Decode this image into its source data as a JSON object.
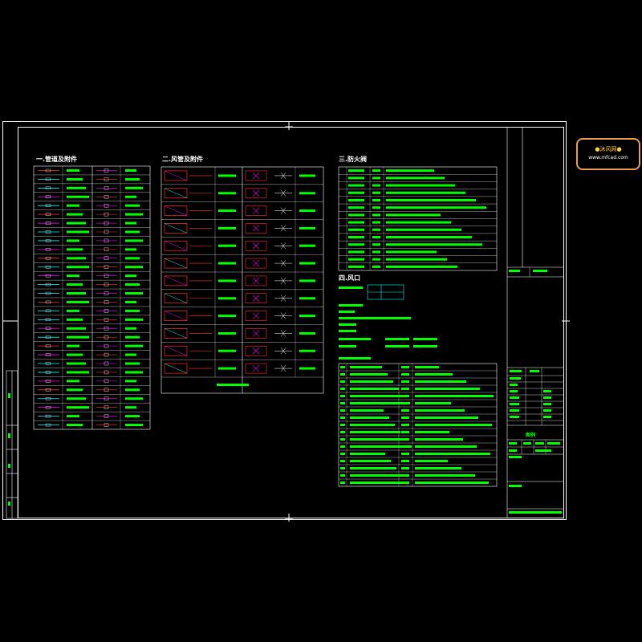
{
  "logo": {
    "line1": "●沐风网●",
    "line2": "www.mfcad.com"
  },
  "sections": {
    "s1": "一.管道及附件",
    "s2": "二.风管及附件",
    "s3": "三.防火阀",
    "s4": "四.风口"
  },
  "colors": {
    "frame": "#ffffff",
    "text": "#00ff00",
    "symbol_red": "#ff3030",
    "symbol_magenta": "#ff00ff",
    "symbol_cyan": "#00ffff",
    "symbol_yellow": "#ffff00",
    "logo_border": "#e8a050"
  },
  "title_block": {
    "drawing_title": "图例"
  }
}
